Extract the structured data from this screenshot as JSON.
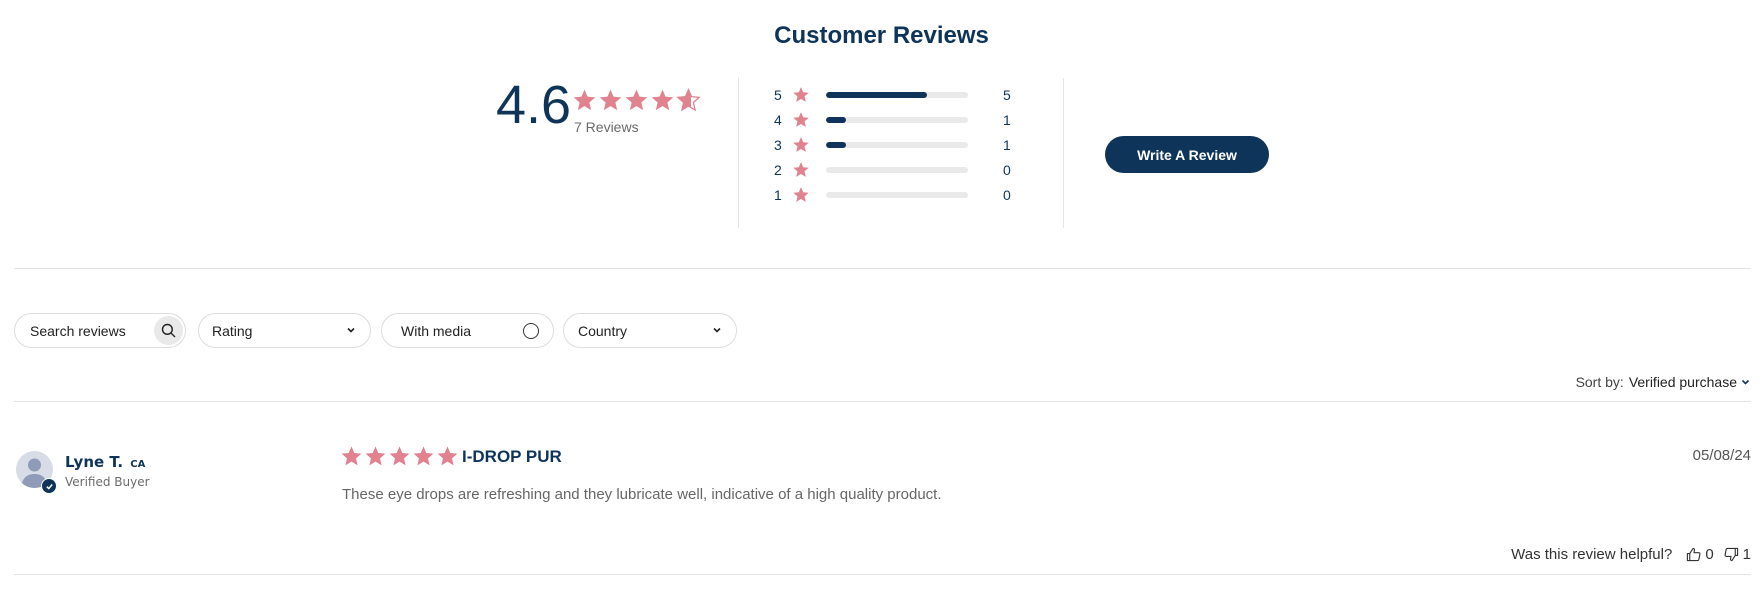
{
  "header": {
    "title": "Customer Reviews"
  },
  "summary": {
    "average": "4.6",
    "average_rating": 4.6,
    "reviews_label": "7 Reviews",
    "star_color": "#e0838f",
    "accent_color": "#0e3559"
  },
  "distribution": [
    {
      "stars": "5",
      "count": "5",
      "fraction": 0.7143
    },
    {
      "stars": "4",
      "count": "1",
      "fraction": 0.1429
    },
    {
      "stars": "3",
      "count": "1",
      "fraction": 0.1429
    },
    {
      "stars": "2",
      "count": "0",
      "fraction": 0
    },
    {
      "stars": "1",
      "count": "0",
      "fraction": 0
    }
  ],
  "actions": {
    "write_review_label": "Write A Review"
  },
  "filters": {
    "search_placeholder": "Search reviews",
    "rating_label": "Rating",
    "media_label": "With media",
    "country_label": "Country"
  },
  "sort": {
    "label": "Sort by:",
    "value": "Verified purchase"
  },
  "reviews": [
    {
      "name": "Lyne T.",
      "country": "CA",
      "badge": "Verified Buyer",
      "rating": 5,
      "title": "I-DROP PUR",
      "date": "05/08/24",
      "body": "These eye drops are refreshing and they lubricate well, indicative of a high quality product.",
      "helpful_prompt": "Was this review helpful?",
      "thumbs_up": "0",
      "thumbs_down": "1"
    }
  ]
}
